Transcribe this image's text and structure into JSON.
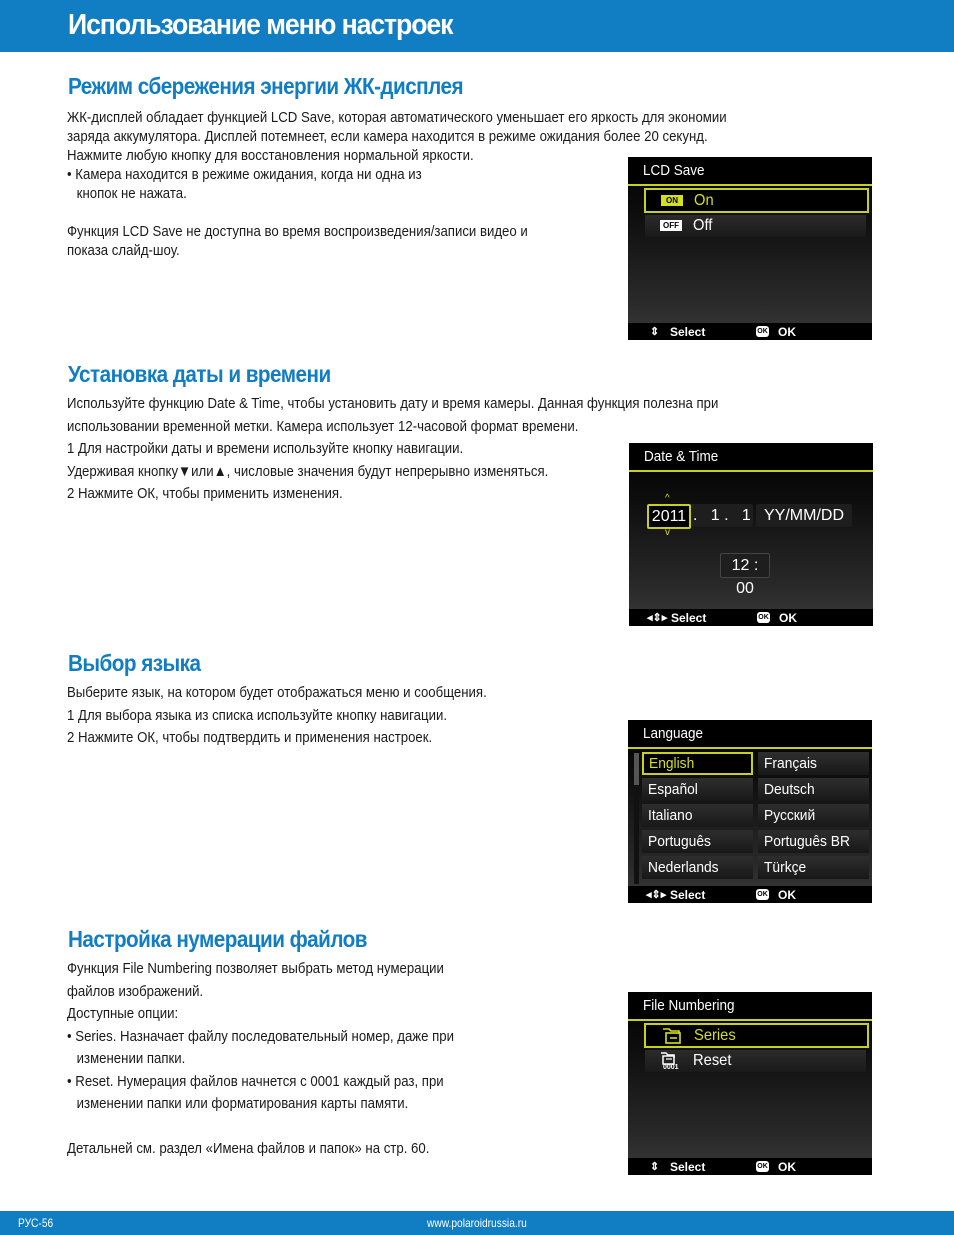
{
  "page": {
    "title": "Использование меню настроек",
    "footer": {
      "page_number": "РУС-56",
      "url": "www.polaroidrussia.ru"
    }
  },
  "colors": {
    "brand_blue": "#117dc2",
    "highlight_yellow": "#c8cf1e"
  },
  "sections": {
    "lcd_save": {
      "heading": "Режим сбережения энергии ЖК-дисплея",
      "lines": [
        "ЖК-дисплей обладает функцией LCD Save, которая автоматического уменьшает его яркость для экономии",
        "заряда аккумулятора. Дисплей потемнеет, если камера находится в режиме ожидания более 20 секунд.",
        "Нажмите любую кнопку для восстановления нормальной яркости.",
        "• Камера находится в режиме ожидания, когда ни одна из",
        "кнопок не нажата.",
        "",
        "Функция LCD Save не доступна во время воспроизведения/записи видео и",
        "показа слайд-шоу."
      ],
      "screen": {
        "title": "LCD Save",
        "options": [
          {
            "badge": "ON",
            "label": "On",
            "selected": true
          },
          {
            "badge": "OFF",
            "label": "Off",
            "selected": false
          }
        ],
        "bar": {
          "nav_icon": "up-down-arrows-icon",
          "select_label": "Select",
          "ok_badge": "OK",
          "ok_label": "OK"
        }
      }
    },
    "date_time": {
      "heading": "Установка даты и времени",
      "lines": [
        "Используйте функцию Date & Time, чтобы установить дату и время камеры. Данная функция полезна при",
        "использовании временной метки. Камера использует 12-часовой формат времени.",
        "1 Для настройки даты и времени используйте кнопку навигации.",
        "Удерживая кнопку",
        "или",
        ", числовые значения будут непрерывно изменяться.",
        "2 Нажмите ОК, чтобы применить изменения."
      ],
      "screen": {
        "title": "Date & Time",
        "year": "2011",
        "month_day": ".   1 .   1",
        "format": "YY/MM/DD",
        "time": "12 : 00",
        "bar": {
          "nav_icon": "four-way-arrows-icon",
          "select_label": "Select",
          "ok_badge": "OK",
          "ok_label": "OK"
        }
      }
    },
    "language": {
      "heading": "Выбор языка",
      "lines": [
        "Выберите язык, на котором будет отображаться меню и сообщения.",
        "1 Для выбора языка из списка используйте кнопку навигации.",
        "2 Нажмите ОК, чтобы подтвердить и применения настроек."
      ],
      "screen": {
        "title": "Language",
        "options": [
          "English",
          "Français",
          "Español",
          "Deutsch",
          "Italiano",
          "Русский",
          "Português",
          "Português BR",
          "Nederlands",
          "Türkçe"
        ],
        "selected": "English",
        "bar": {
          "nav_icon": "four-way-arrows-icon",
          "select_label": "Select",
          "ok_badge": "OK",
          "ok_label": "OK"
        }
      }
    },
    "file_numbering": {
      "heading": "Настройка нумерации файлов",
      "lines": [
        "Функция File Numbering позволяет выбрать метод нумерации",
        "файлов изображений.",
        "Доступные опции:",
        "• Series. Назначает файлу последовательный номер, даже при",
        "изменении папки.",
        "• Reset. Нумерация файлов начнется с 0001 каждый раз, при",
        "изменении папки или форматирования карты памяти.",
        "",
        "Детальней см. раздел «Имена файлов и папок» на стр. 60."
      ],
      "screen": {
        "title": "File Numbering",
        "options": [
          {
            "icon": "folder-series-icon",
            "label": "Series",
            "selected": true
          },
          {
            "icon": "folder-reset-0001-icon",
            "icon_text": "0001",
            "label": "Reset",
            "selected": false
          }
        ],
        "bar": {
          "nav_icon": "up-down-arrows-icon",
          "select_label": "Select",
          "ok_badge": "OK",
          "ok_label": "OK"
        }
      }
    }
  }
}
